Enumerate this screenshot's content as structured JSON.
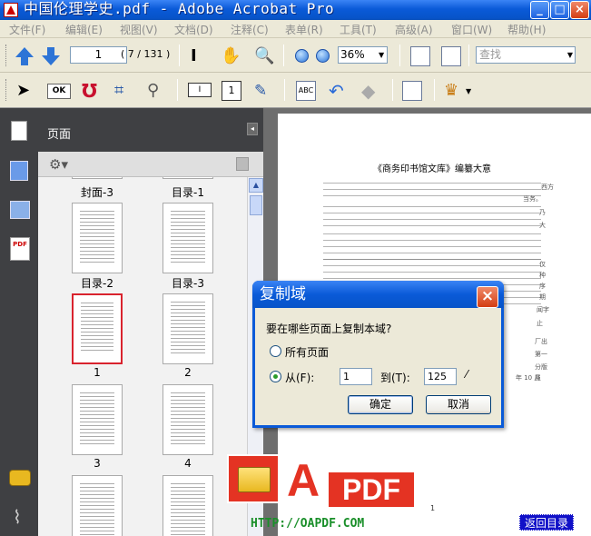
{
  "window": {
    "title": "中国伦理学史.pdf - Adobe Acrobat Pro",
    "minimize": "_",
    "maximize": "□",
    "close": "×"
  },
  "menu": [
    "文件(F)",
    "编辑(E)",
    "视图(V)",
    "文档(D)",
    "注释(C)",
    "表单(R)",
    "工具(T)",
    "高级(A)",
    "窗口(W)",
    "帮助(H)"
  ],
  "toolbar": {
    "page_number": "1",
    "page_count": "( 7 / 131 )",
    "zoom": "36%",
    "search_placeholder": "查找",
    "ok_label": "OK"
  },
  "panel": {
    "title": "页面",
    "collapse": "◂",
    "thumbnails": [
      {
        "label": "封面-3",
        "selected": false
      },
      {
        "label": "目录-1",
        "selected": false
      },
      {
        "label": "目录-2",
        "selected": false
      },
      {
        "label": "目录-3",
        "selected": false
      },
      {
        "label": "1",
        "selected": true
      },
      {
        "label": "2",
        "selected": false
      },
      {
        "label": "3",
        "selected": false
      },
      {
        "label": "4",
        "selected": false
      }
    ]
  },
  "document": {
    "heading": "《商务印书馆文库》编纂大意",
    "right_fragments": [
      "当务。",
      "西方",
      "乃",
      "大",
      "仅",
      "种",
      "序",
      "期",
      "闻字",
      "止",
      "厂出",
      "第一",
      "分版",
      "员"
    ],
    "year_fragment": "年 10 月",
    "page_number": "1"
  },
  "dialog": {
    "title": "复制域",
    "close": "×",
    "question": "要在哪些页面上复制本域?",
    "option_all": "所有页面",
    "option_from": "从(F):",
    "from_value": "1",
    "to_label": "到(T):",
    "to_value": "125",
    "ok": "确定",
    "cancel": "取消"
  },
  "watermark": {
    "logo_letter": "A",
    "logo_pdf": "PDF",
    "url": "HTTP://OAPDF.COM",
    "return_link": "返回目录"
  },
  "colors": {
    "xp_blue": "#0a5ad8",
    "logo_red": "#e43323",
    "url_green": "#1a8f2a",
    "selected_thumb": "#d9232e"
  }
}
